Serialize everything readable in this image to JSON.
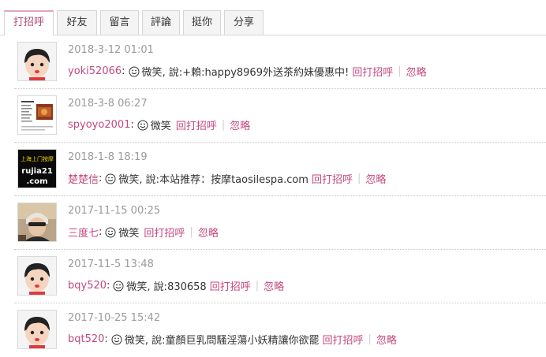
{
  "tabs": [
    {
      "label": "打招呼",
      "active": true
    },
    {
      "label": "好友",
      "active": false
    },
    {
      "label": "留言",
      "active": false
    },
    {
      "label": "評論",
      "active": false
    },
    {
      "label": "挺你",
      "active": false
    },
    {
      "label": "分享",
      "active": false
    }
  ],
  "greet_back_label": "回打招呼",
  "ignore_label": "忽略",
  "items": [
    {
      "time": "2018-3-12 01:01",
      "user": "yoki52066",
      "action": "微笑",
      "message": ", 說:+賴:happy8969外送茶約妹優惠中!",
      "avatar": "cartoon-girl"
    },
    {
      "time": "2018-3-8 06:27",
      "user": "spyoyo2001",
      "action": "微笑",
      "message": "",
      "avatar": "document-thumb"
    },
    {
      "time": "2018-1-8 18:19",
      "user": "楚楚信",
      "action": "微笑",
      "message": ", 說:本站推荐：按摩taosilespa.com",
      "avatar": "ad-banner",
      "avatar_text": [
        "上海上门按摩",
        "rujia21",
        ".com"
      ]
    },
    {
      "time": "2017-11-15 00:25",
      "user": "三度七",
      "action": "微笑",
      "message": "",
      "avatar": "photo-person"
    },
    {
      "time": "2017-11-5 13:48",
      "user": "bqy520",
      "action": "微笑",
      "message": ", 說:830658",
      "avatar": "cartoon-girl"
    },
    {
      "time": "2017-10-25 15:42",
      "user": "bqt520",
      "action": "微笑",
      "message": ", 說:童顏巨乳問騷淫蕩小妖精讓你欲罷",
      "avatar": "cartoon-girl"
    }
  ],
  "colors": {
    "accent": "#c4487f",
    "time": "#9a9a9a",
    "tab_active_border": "#e2a5bd"
  }
}
